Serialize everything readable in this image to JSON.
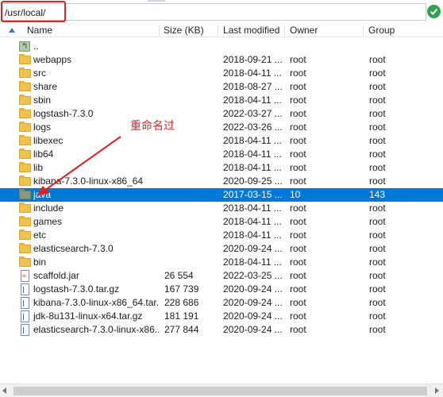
{
  "path_bar": {
    "value": "/usr/local/"
  },
  "columns": {
    "name": "Name",
    "size": "Size (KB)",
    "modified": "Last modified",
    "owner": "Owner",
    "group": "Group"
  },
  "annotation": {
    "text": "重命名过",
    "color": "#e02020"
  },
  "colors": {
    "selection": "#0078d7",
    "folder": "#f0c24f",
    "highlight": "#e02020"
  },
  "files": [
    {
      "icon": "up-folder-icon",
      "name": "..",
      "size": "",
      "modified": "",
      "owner": "",
      "group": "",
      "selected": false
    },
    {
      "icon": "folder-icon",
      "name": "webapps",
      "size": "",
      "modified": "2018-09-21 ...",
      "owner": "root",
      "group": "root",
      "selected": false
    },
    {
      "icon": "folder-icon",
      "name": "src",
      "size": "",
      "modified": "2018-04-11 ...",
      "owner": "root",
      "group": "root",
      "selected": false
    },
    {
      "icon": "folder-icon",
      "name": "share",
      "size": "",
      "modified": "2018-08-27 ...",
      "owner": "root",
      "group": "root",
      "selected": false
    },
    {
      "icon": "folder-icon",
      "name": "sbin",
      "size": "",
      "modified": "2018-04-11 ...",
      "owner": "root",
      "group": "root",
      "selected": false
    },
    {
      "icon": "folder-icon",
      "name": "logstash-7.3.0",
      "size": "",
      "modified": "2022-03-27 ...",
      "owner": "root",
      "group": "root",
      "selected": false
    },
    {
      "icon": "folder-icon",
      "name": "logs",
      "size": "",
      "modified": "2022-03-26 ...",
      "owner": "root",
      "group": "root",
      "selected": false
    },
    {
      "icon": "folder-icon",
      "name": "libexec",
      "size": "",
      "modified": "2018-04-11 ...",
      "owner": "root",
      "group": "root",
      "selected": false
    },
    {
      "icon": "folder-icon",
      "name": "lib64",
      "size": "",
      "modified": "2018-04-11 ...",
      "owner": "root",
      "group": "root",
      "selected": false
    },
    {
      "icon": "folder-icon",
      "name": "lib",
      "size": "",
      "modified": "2018-04-11 ...",
      "owner": "root",
      "group": "root",
      "selected": false
    },
    {
      "icon": "folder-icon",
      "name": "kibana-7.3.0-linux-x86_64",
      "size": "",
      "modified": "2020-09-25 ...",
      "owner": "root",
      "group": "root",
      "selected": false
    },
    {
      "icon": "folder-icon",
      "name": "java",
      "size": "",
      "modified": "2017-03-15 ...",
      "owner": "10",
      "group": "143",
      "selected": true
    },
    {
      "icon": "folder-icon",
      "name": "include",
      "size": "",
      "modified": "2018-04-11 ...",
      "owner": "root",
      "group": "root",
      "selected": false
    },
    {
      "icon": "folder-icon",
      "name": "games",
      "size": "",
      "modified": "2018-04-11 ...",
      "owner": "root",
      "group": "root",
      "selected": false
    },
    {
      "icon": "folder-icon",
      "name": "etc",
      "size": "",
      "modified": "2018-04-11 ...",
      "owner": "root",
      "group": "root",
      "selected": false
    },
    {
      "icon": "folder-icon",
      "name": "elasticsearch-7.3.0",
      "size": "",
      "modified": "2020-09-24 ...",
      "owner": "root",
      "group": "root",
      "selected": false
    },
    {
      "icon": "folder-icon",
      "name": "bin",
      "size": "",
      "modified": "2018-04-11 ...",
      "owner": "root",
      "group": "root",
      "selected": false
    },
    {
      "icon": "jar-file-icon",
      "name": "scaffold.jar",
      "size": "26 554",
      "modified": "2022-03-25 ...",
      "owner": "root",
      "group": "root",
      "selected": false
    },
    {
      "icon": "archive-file-icon",
      "name": "logstash-7.3.0.tar.gz",
      "size": "167 739",
      "modified": "2020-09-24 ...",
      "owner": "root",
      "group": "root",
      "selected": false
    },
    {
      "icon": "archive-file-icon",
      "name": "kibana-7.3.0-linux-x86_64.tar....",
      "size": "228 686",
      "modified": "2020-09-24 ...",
      "owner": "root",
      "group": "root",
      "selected": false
    },
    {
      "icon": "archive-file-icon",
      "name": "jdk-8u131-linux-x64.tar.gz",
      "size": "181 191",
      "modified": "2020-09-24 ...",
      "owner": "root",
      "group": "root",
      "selected": false
    },
    {
      "icon": "archive-file-icon",
      "name": "elasticsearch-7.3.0-linux-x86...",
      "size": "277 844",
      "modified": "2020-09-24 ...",
      "owner": "root",
      "group": "root",
      "selected": false
    }
  ]
}
